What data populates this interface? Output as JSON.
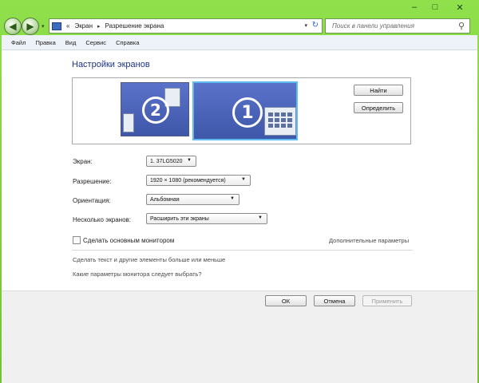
{
  "window": {
    "minimize_glyph": "–",
    "maximize_glyph": "□",
    "close_glyph": "✕"
  },
  "address": {
    "breadcrumb_root": "«",
    "part1": "Экран",
    "part2": "Разрешение экрана",
    "separator": "▸",
    "dropdown_glyph": "▾",
    "refresh_glyph": "↻"
  },
  "search": {
    "placeholder": "Поиск в панели управления",
    "icon": "search-icon",
    "icon_glyph": "⚲"
  },
  "nav": {
    "back_glyph": "◀",
    "forward_glyph": "▶",
    "history_glyph": "▾"
  },
  "menu": [
    "Файл",
    "Правка",
    "Вид",
    "Сервис",
    "Справка"
  ],
  "main": {
    "title": "Настройки экранов",
    "monitor1_label": "1",
    "monitor2_label": "2",
    "find_button": "Найти",
    "identify_button": "Определить",
    "screen_label": "Экран:",
    "screen_value": "1. 37LG5020",
    "resolution_label": "Разрешение:",
    "resolution_value": "1920 × 1080 (рекомендуется)",
    "orientation_label": "Ориентация:",
    "orientation_value": "Альбомная",
    "multiple_label": "Несколько экранов:",
    "multiple_value": "Расширить эти экраны",
    "primary_checkbox": "Сделать основным монитором",
    "advanced_link": "Дополнительные параметры",
    "text_size_link": "Сделать текст и другие элементы больше или меньше",
    "which_settings_link": "Какие параметры монитора следует выбрать?"
  },
  "footer": {
    "ok": "ОК",
    "cancel": "Отмена",
    "apply": "Применить"
  },
  "colors": {
    "title_blue": "#1e3287",
    "frame_green": "#7fcf3c",
    "selected_border": "#5fbaf0"
  }
}
